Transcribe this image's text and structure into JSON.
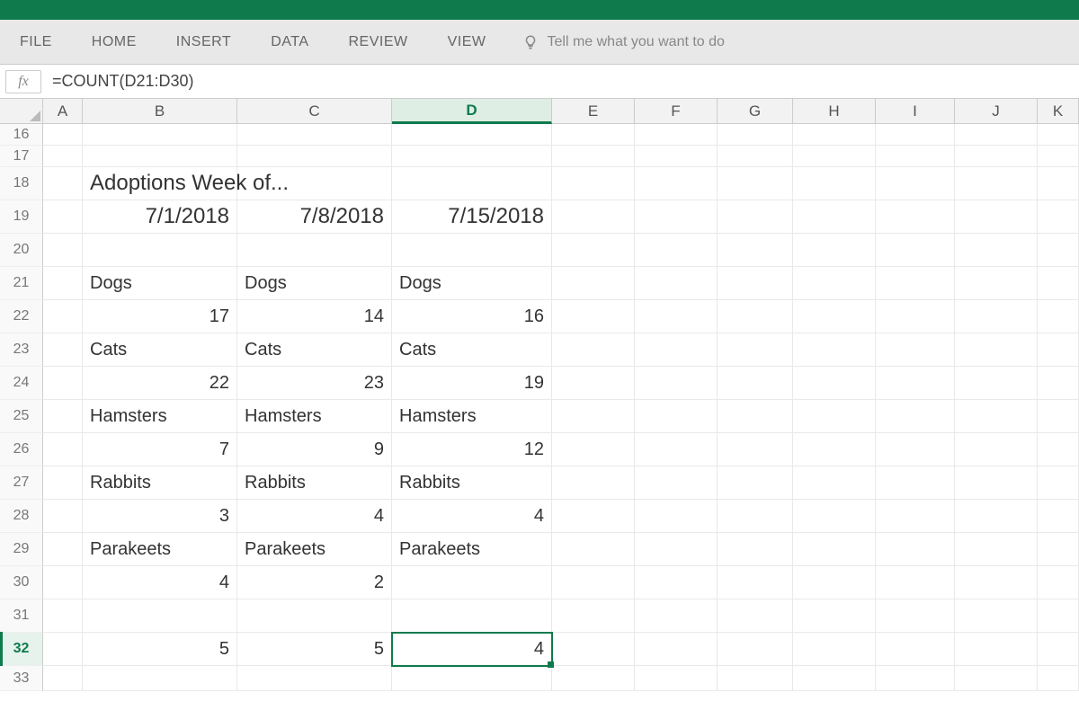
{
  "titlebar": {
    "color": "#0f7b4d"
  },
  "ribbon": {
    "tabs": [
      "FILE",
      "HOME",
      "INSERT",
      "DATA",
      "REVIEW",
      "VIEW"
    ],
    "tell_me_placeholder": "Tell me what you want to do"
  },
  "formula_bar": {
    "fx_label": "fx",
    "value": "=COUNT(D21:D30)"
  },
  "columns": [
    "A",
    "B",
    "C",
    "D",
    "E",
    "F",
    "G",
    "H",
    "I",
    "J",
    "K"
  ],
  "col_classes": [
    "cA",
    "cB",
    "cC",
    "cD",
    "cE",
    "cF",
    "cG",
    "cH",
    "cI",
    "cJ",
    "cK"
  ],
  "selected_col": "D",
  "row_start": 16,
  "row_end": 33,
  "selected_row": 32,
  "active_cell": "D32",
  "cells": {
    "B18": {
      "v": "Adoptions Week of...",
      "align": "l",
      "big": true
    },
    "B19": {
      "v": "7/1/2018",
      "align": "r",
      "big": true
    },
    "C19": {
      "v": "7/8/2018",
      "align": "r",
      "big": true
    },
    "D19": {
      "v": "7/15/2018",
      "align": "r",
      "big": true
    },
    "B21": {
      "v": "Dogs",
      "align": "l"
    },
    "C21": {
      "v": "Dogs",
      "align": "l"
    },
    "D21": {
      "v": "Dogs",
      "align": "l"
    },
    "B22": {
      "v": "17",
      "align": "r"
    },
    "C22": {
      "v": "14",
      "align": "r"
    },
    "D22": {
      "v": "16",
      "align": "r"
    },
    "B23": {
      "v": "Cats",
      "align": "l"
    },
    "C23": {
      "v": "Cats",
      "align": "l"
    },
    "D23": {
      "v": "Cats",
      "align": "l"
    },
    "B24": {
      "v": "22",
      "align": "r"
    },
    "C24": {
      "v": "23",
      "align": "r"
    },
    "D24": {
      "v": "19",
      "align": "r"
    },
    "B25": {
      "v": "Hamsters",
      "align": "l"
    },
    "C25": {
      "v": "Hamsters",
      "align": "l"
    },
    "D25": {
      "v": "Hamsters",
      "align": "l"
    },
    "B26": {
      "v": "7",
      "align": "r"
    },
    "C26": {
      "v": "9",
      "align": "r"
    },
    "D26": {
      "v": "12",
      "align": "r"
    },
    "B27": {
      "v": "Rabbits",
      "align": "l"
    },
    "C27": {
      "v": "Rabbits",
      "align": "l"
    },
    "D27": {
      "v": "Rabbits",
      "align": "l"
    },
    "B28": {
      "v": "3",
      "align": "r"
    },
    "C28": {
      "v": "4",
      "align": "r"
    },
    "D28": {
      "v": "4",
      "align": "r"
    },
    "B29": {
      "v": "Parakeets",
      "align": "l"
    },
    "C29": {
      "v": "Parakeets",
      "align": "l"
    },
    "D29": {
      "v": "Parakeets",
      "align": "l"
    },
    "B30": {
      "v": "4",
      "align": "r"
    },
    "C30": {
      "v": "2",
      "align": "r"
    },
    "B32": {
      "v": "5",
      "align": "r"
    },
    "C32": {
      "v": "5",
      "align": "r"
    },
    "D32": {
      "v": "4",
      "align": "r"
    }
  }
}
